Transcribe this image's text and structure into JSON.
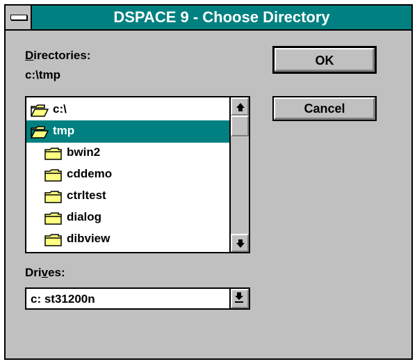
{
  "window": {
    "title": "DSPACE 9 - Choose Directory"
  },
  "directories": {
    "label_prefix": "",
    "label_mnemonic": "D",
    "label_rest": "irectories:",
    "current_path": "c:\\tmp",
    "items": [
      {
        "name": "c:\\",
        "icon": "open-folder-icon",
        "selected": false
      },
      {
        "name": "tmp",
        "icon": "open-folder-icon",
        "selected": true
      },
      {
        "name": "bwin2",
        "icon": "folder-icon",
        "selected": false
      },
      {
        "name": "cddemo",
        "icon": "folder-icon",
        "selected": false
      },
      {
        "name": "ctrltest",
        "icon": "folder-icon",
        "selected": false
      },
      {
        "name": "dialog",
        "icon": "folder-icon",
        "selected": false
      },
      {
        "name": "dibview",
        "icon": "folder-icon",
        "selected": false
      }
    ]
  },
  "drives": {
    "label_prefix": "Dri",
    "label_mnemonic": "v",
    "label_rest": "es:",
    "selected": "c: st31200n"
  },
  "buttons": {
    "ok": "OK",
    "cancel": "Cancel"
  },
  "colors": {
    "titlebar": "#008080",
    "selection": "#008080",
    "face": "#c0c0c0"
  }
}
